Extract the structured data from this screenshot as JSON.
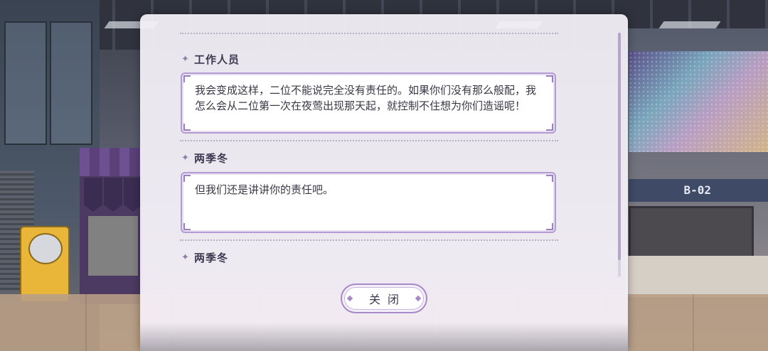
{
  "dialog": {
    "entries": [
      {
        "speaker": "工作人员",
        "text": "我会变成这样，二位不能说完全没有责任的。如果你们没有那么般配，我怎么会从二位第一次在夜莺出现那天起，就控制不住想为你们造谣呢！"
      },
      {
        "speaker": "两季冬",
        "text": "但我们还是讲讲你的责任吧。"
      },
      {
        "speaker": "两季冬",
        "text": ""
      }
    ],
    "close_label": "关闭"
  },
  "scene": {
    "sign_label": "B-02"
  },
  "colors": {
    "accent": "#b59bd3",
    "panel": "#f4f0f8",
    "text": "#3b3746"
  },
  "icons": {
    "speaker_marker": "sparkle-icon"
  }
}
